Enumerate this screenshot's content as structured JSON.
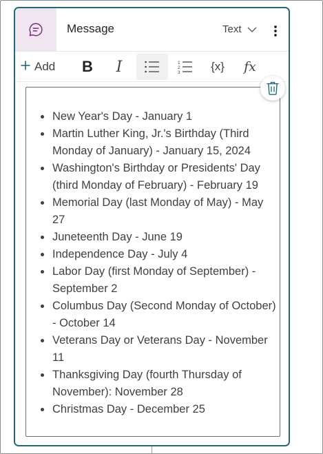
{
  "node": {
    "title": "Message",
    "icon": "message-bubble-icon",
    "format_label": "Text",
    "accent_color": "#1e6a7a",
    "icon_bg_color": "#f0e6f0",
    "icon_color": "#7a2e7a"
  },
  "toolbar": {
    "add_label": "Add",
    "formula_label": "fx",
    "variable_label": "{x}",
    "bold_label": "B",
    "italic_label": "I",
    "active_tool": "bulleted-list"
  },
  "message_items": [
    "New Year's Day - January 1",
    "Martin Luther King, Jr.'s Birthday (Third Monday of January) - January 15, 2024",
    "Washington's Birthday or Presidents' Day (third Monday of February) - February 19",
    "Memorial Day (last Monday of May) - May 27",
    "Juneteenth Day - June 19",
    "Independence Day - July 4",
    "Labor Day (first Monday of September) - September 2",
    "Columbus Day (Second Monday of October) - October 14",
    "Veterans Day or Veterans Day - November 11",
    "Thanksgiving Day (fourth Thursday of November): November 28",
    "Christmas Day - December 25"
  ]
}
